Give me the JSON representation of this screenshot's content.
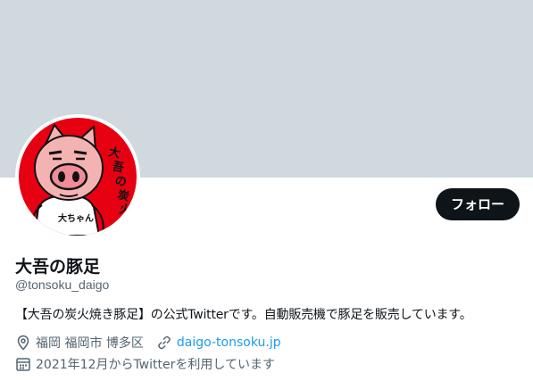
{
  "profile": {
    "display_name": "大吾の豚足",
    "handle": "@tonsoku_daigo",
    "bio": "【大吾の炭火焼き豚足】の公式Twitterです。自動販売機で豚足を販売しています。",
    "location": "福岡 福岡市 博多区",
    "website": "daigo-tonsoku.jp",
    "joined": "2021年12月からTwitterを利用しています",
    "avatar_text": "大吾の炭火焼き",
    "avatar_shirt_text": "大ちゃん"
  },
  "actions": {
    "follow_label": "フォロー"
  },
  "colors": {
    "banner": "#cfd9de",
    "avatar_bg": "#e60012",
    "link": "#1d9bf0",
    "secondary_text": "#536471",
    "button_bg": "#0f1419"
  },
  "icons": {
    "location": "location-pin-icon",
    "website": "link-icon",
    "joined": "calendar-icon"
  }
}
